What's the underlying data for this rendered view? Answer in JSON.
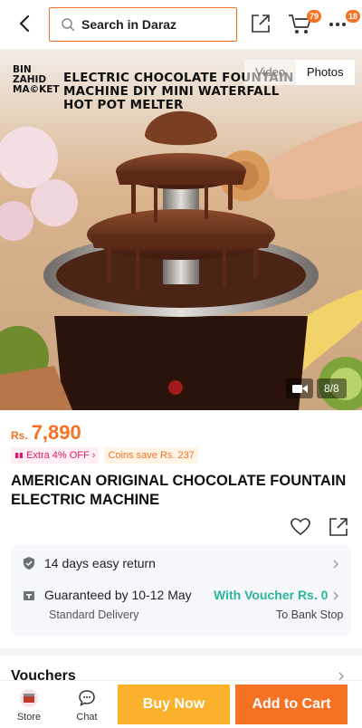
{
  "header": {
    "search_placeholder": "Search in Daraz",
    "cart_count": "79",
    "more_count": "18"
  },
  "gallery": {
    "watermark": "BIN ZAHID MA©KET",
    "banner": "ELECTRIC CHOCOLATE FOUNTAIN MACHINE DIY MINI WATERFALL HOT POT MELTER",
    "tabs": {
      "video": "Video",
      "photos": "Photos"
    },
    "counter": "8/8"
  },
  "product": {
    "currency": "Rs.",
    "price": "7,890",
    "promo_extra": "Extra 4% OFF",
    "promo_coins": "Coins save Rs. 237",
    "title": "AMERICAN ORIGINAL CHOCOLATE FOUNTAIN ELECTRIC MACHINE"
  },
  "info": {
    "returns": "14 days easy return",
    "delivery_title": "Guaranteed by 10-12 May",
    "delivery_sub": "Standard Delivery",
    "voucher_title": "With Voucher Rs. 0",
    "voucher_sub": "To Bank Stop"
  },
  "vouchers": {
    "title": "Vouchers"
  },
  "bottom": {
    "store": "Store",
    "chat": "Chat",
    "buy_now": "Buy Now",
    "add_to_cart": "Add to Cart"
  },
  "colors": {
    "accent": "#f57224",
    "buy": "#fbb12b",
    "green": "#2bb59c"
  }
}
